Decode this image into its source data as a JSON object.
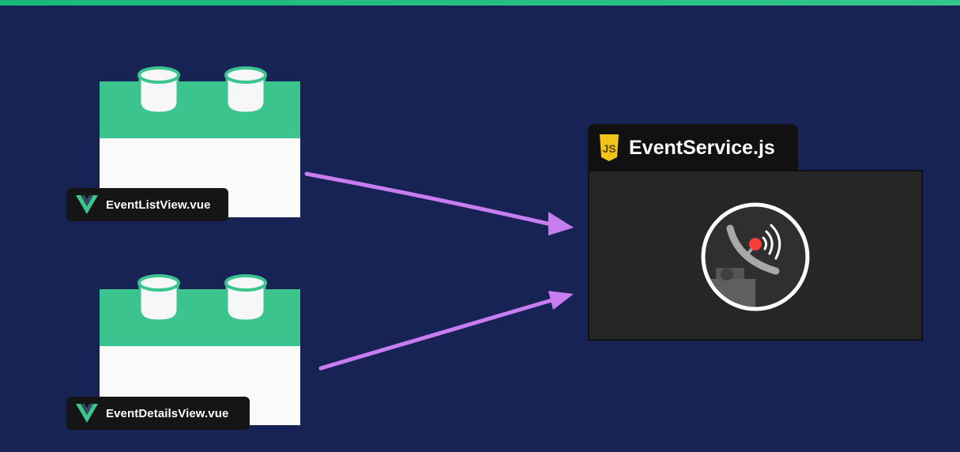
{
  "components": [
    {
      "file": "EventListView.vue",
      "icon": "vue-logo-icon"
    },
    {
      "file": "EventDetailsView.vue",
      "icon": "vue-logo-icon"
    }
  ],
  "service": {
    "file": "EventService.js",
    "badge": "JS",
    "icon": "satellite-dish-icon"
  },
  "colors": {
    "background": "#172354",
    "block_green": "#3cc48f",
    "block_white": "#fafafa",
    "arrow": "#c77df0",
    "label_bg": "#151515",
    "js_yellow": "#f0c419",
    "panel_bg": "#262626"
  }
}
